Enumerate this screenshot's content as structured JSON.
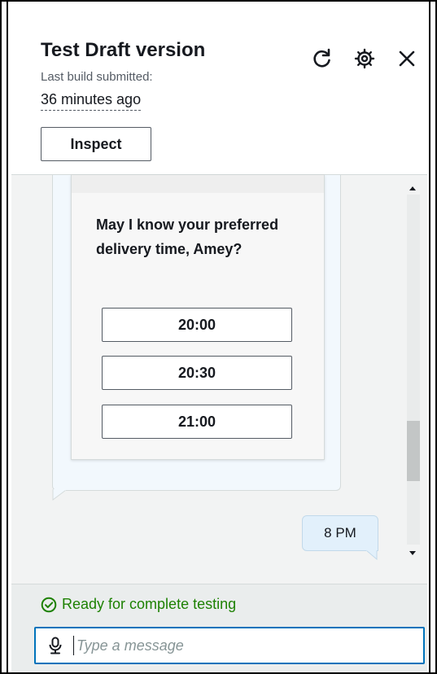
{
  "header": {
    "title": "Test Draft version",
    "subtitle": "Last build submitted:",
    "time_ago": "36 minutes ago",
    "inspect_label": "Inspect"
  },
  "icons": {
    "refresh": "refresh-icon",
    "settings": "gear-icon",
    "close": "close-icon",
    "status": "check-circle-icon",
    "mic": "microphone-icon"
  },
  "chat": {
    "bot_question": "May I know your preferred delivery time, Amey?",
    "options": [
      "20:00",
      "20:30",
      "21:00"
    ],
    "user_message": "8 PM"
  },
  "footer": {
    "status_text": "Ready for complete testing",
    "input_placeholder": "Type a message",
    "input_value": ""
  },
  "colors": {
    "accent": "#0073bb",
    "status_green": "#1d8102",
    "bot_bubble": "#f2f8fd",
    "user_bubble": "#e2f0fb"
  }
}
